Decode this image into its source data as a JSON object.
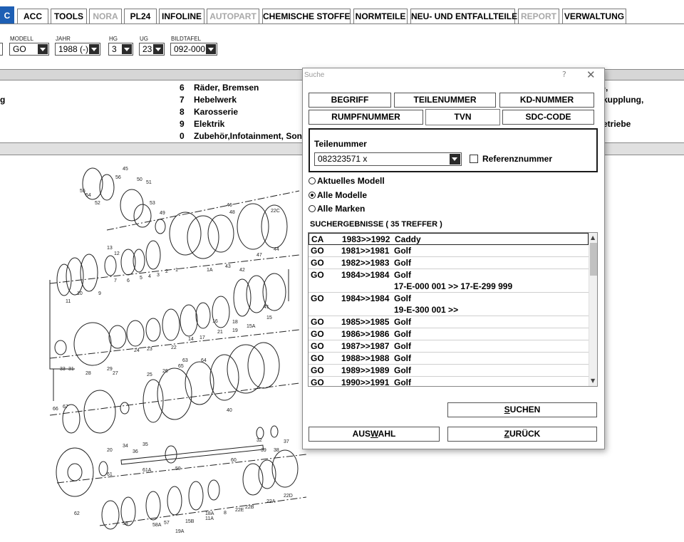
{
  "tabs": [
    {
      "label": "C",
      "state": "active"
    },
    {
      "label": "ACC",
      "state": "normal"
    },
    {
      "label": "TOOLS",
      "state": "normal"
    },
    {
      "label": "NORA",
      "state": "disabled"
    },
    {
      "label": "PL24",
      "state": "normal"
    },
    {
      "label": "INFOLINE",
      "state": "normal"
    },
    {
      "label": "AUTOPART",
      "state": "disabled"
    },
    {
      "label": "CHEMISCHE STOFFE",
      "state": "normal"
    },
    {
      "label": "NORMTEILE",
      "state": "normal"
    },
    {
      "label": "NEU- UND ENTFALLTEILE",
      "state": "normal"
    },
    {
      "label": "REPORT",
      "state": "disabled"
    },
    {
      "label": "VERWALTUNG",
      "state": "normal"
    }
  ],
  "fields": {
    "modell": {
      "label": "MODELL",
      "value": "GO"
    },
    "jahr": {
      "label": "JAHR",
      "value": "1988 (-)"
    },
    "hg": {
      "label": "HG",
      "value": "3"
    },
    "ug": {
      "label": "UG",
      "value": "23"
    },
    "bildtafel": {
      "label": "BILDTAFEL",
      "value": "092-000"
    }
  },
  "groups": [
    {
      "left": "",
      "num": "6",
      "text": "Räder, Bremsen",
      "right": "-,"
    },
    {
      "left": "g",
      "num": "7",
      "text": "Hebelwerk",
      "right": "kupplung,"
    },
    {
      "left": "",
      "num": "8",
      "text": "Karosserie",
      "right": ""
    },
    {
      "left": "",
      "num": "9",
      "text": "Elektrik",
      "right": "etriebe"
    },
    {
      "left": "",
      "num": "0",
      "text": "Zubehör,Infotainment, Sonstig",
      "right": ""
    }
  ],
  "dialog": {
    "title": "Suche",
    "help_icon": "?",
    "close_icon": "✕",
    "tabs_row1": [
      "BEGRIFF",
      "TEILENUMMER",
      "KD-NUMMER"
    ],
    "tabs_row2": [
      "RUMPFNUMMER",
      "TVN",
      "SDC-CODE"
    ],
    "active_tab": "TVN",
    "entry": {
      "label": "Teilenummer",
      "value": "082323571 x",
      "checkbox_label": "Referenznummer",
      "checked": false
    },
    "scope": [
      {
        "label": "Aktuelles Modell",
        "selected": false
      },
      {
        "label": "Alle Modelle",
        "selected": true
      },
      {
        "label": "Alle Marken",
        "selected": false
      }
    ],
    "results_header": "SUCHERGEBNISSE   ( 35 TREFFER )",
    "results": [
      {
        "model": "CA",
        "years": "1983>>1992",
        "name": "Caddy",
        "note": ""
      },
      {
        "model": "GO",
        "years": "1981>>1981",
        "name": "Golf",
        "note": ""
      },
      {
        "model": "GO",
        "years": "1982>>1983",
        "name": "Golf",
        "note": ""
      },
      {
        "model": "GO",
        "years": "1984>>1984",
        "name": "Golf",
        "note": "17-E-000 001 >> 17-E-299 999"
      },
      {
        "model": "GO",
        "years": "1984>>1984",
        "name": "Golf",
        "note": "19-E-300 001 >>"
      },
      {
        "model": "GO",
        "years": "1985>>1985",
        "name": "Golf",
        "note": ""
      },
      {
        "model": "GO",
        "years": "1986>>1986",
        "name": "Golf",
        "note": ""
      },
      {
        "model": "GO",
        "years": "1987>>1987",
        "name": "Golf",
        "note": ""
      },
      {
        "model": "GO",
        "years": "1988>>1988",
        "name": "Golf",
        "note": ""
      },
      {
        "model": "GO",
        "years": "1989>>1989",
        "name": "Golf",
        "note": ""
      },
      {
        "model": "GO",
        "years": "1990>>1991",
        "name": "Golf",
        "note": ""
      }
    ],
    "buttons": {
      "suchen_pre": "",
      "suchen_key": "S",
      "suchen_post": "UCHEN",
      "auswahl_pre": "AUS",
      "auswahl_key": "W",
      "auswahl_post": "AHL",
      "zurueck_pre": "",
      "zurueck_key": "Z",
      "zurueck_post": "URÜCK"
    }
  },
  "drawing_labels": [
    "45",
    "56",
    "50",
    "51",
    "55",
    "54",
    "52",
    "53",
    "49",
    "46",
    "48",
    "47",
    "44",
    "13",
    "12",
    "9",
    "10",
    "11",
    "7",
    "6",
    "5",
    "4",
    "3",
    "2",
    "1",
    "1A",
    "43",
    "42",
    "41",
    "15",
    "15A",
    "19",
    "21",
    "18",
    "16",
    "17",
    "14",
    "22",
    "23",
    "24",
    "33",
    "31",
    "29",
    "28",
    "27",
    "25",
    "26",
    "65",
    "63",
    "64",
    "40",
    "66",
    "67",
    "20",
    "34",
    "36",
    "35",
    "32",
    "39",
    "38",
    "37",
    "61",
    "61A",
    "62",
    "59",
    "60",
    "58",
    "58A",
    "57",
    "11A",
    "8",
    "22E",
    "22B",
    "22A",
    "22D",
    "15B",
    "19A",
    "18A",
    "22C"
  ]
}
